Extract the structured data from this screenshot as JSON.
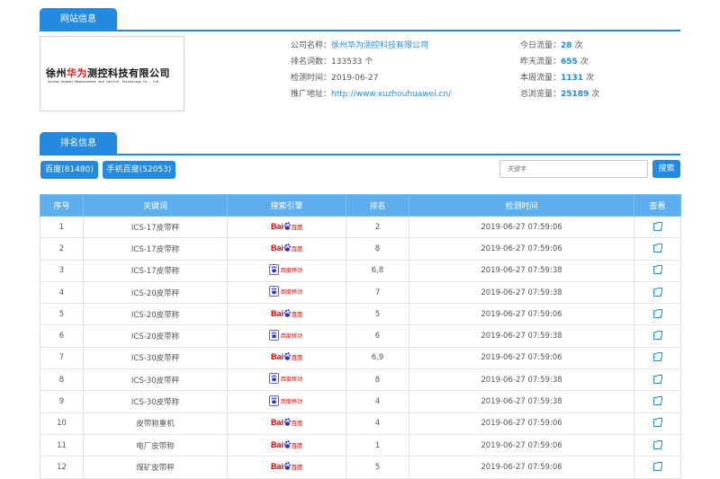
{
  "site_info": {
    "tab": "网站信息",
    "logo": {
      "brand_red": "华为",
      "text_cn": "徐州华为测控科技有限公司",
      "text_en": "Xuzhou Huawei Measurement and Control Technology Co., Ltd."
    },
    "company_label": "公司名称：",
    "company_value": "徐州华为测控科技有限公司",
    "rank_words_label": "排名词数：",
    "rank_words_value": "133533 个",
    "check_time_label": "检测时间：",
    "check_time_value": "2019-06-27",
    "url_label": "推广地址：",
    "url_value": "http://www.xuzhouhuawei.cn/",
    "traffic": [
      {
        "label": "今日流量：",
        "value": "28",
        "unit": "次"
      },
      {
        "label": "昨天流量：",
        "value": "655",
        "unit": "次"
      },
      {
        "label": "本周流量：",
        "value": "1131",
        "unit": "次"
      },
      {
        "label": "总浏览量：",
        "value": "25189",
        "unit": "次"
      }
    ]
  },
  "ranking": {
    "tab": "排名信息",
    "btn_baidu": "百度(81480)",
    "btn_mobile": "手机百度(52053)",
    "search_placeholder": "关键字",
    "search_button": "搜索",
    "columns": [
      "序号",
      "关键词",
      "搜索引擎",
      "排名",
      "检测时间",
      "查看"
    ],
    "engines": {
      "pc_bai": "Bai",
      "pc_du": "百度",
      "mobile": "百度移动"
    },
    "rows": [
      {
        "no": "1",
        "keyword": "ICS-17皮带秤",
        "engine": "pc",
        "rank": "2",
        "time": "2019-06-27 07:59:06"
      },
      {
        "no": "2",
        "keyword": "ICS-17皮带称",
        "engine": "pc",
        "rank": "8",
        "time": "2019-06-27 07:59:06"
      },
      {
        "no": "3",
        "keyword": "ICS-17皮带称",
        "engine": "mobile",
        "rank": "6,8",
        "time": "2019-06-27 07:59:38"
      },
      {
        "no": "4",
        "keyword": "ICS-20皮带秤",
        "engine": "mobile",
        "rank": "7",
        "time": "2019-06-27 07:59:38"
      },
      {
        "no": "5",
        "keyword": "ICS-20皮带称",
        "engine": "pc",
        "rank": "5",
        "time": "2019-06-27 07:59:06"
      },
      {
        "no": "6",
        "keyword": "ICS-20皮带称",
        "engine": "mobile",
        "rank": "6",
        "time": "2019-06-27 07:59:38"
      },
      {
        "no": "7",
        "keyword": "ICS-30皮带秤",
        "engine": "pc",
        "rank": "6,9",
        "time": "2019-06-27 07:59:06"
      },
      {
        "no": "8",
        "keyword": "ICS-30皮带秤",
        "engine": "mobile",
        "rank": "8",
        "time": "2019-06-27 07:59:38"
      },
      {
        "no": "9",
        "keyword": "ICS-30皮带称",
        "engine": "mobile",
        "rank": "4",
        "time": "2019-06-27 07:59:38"
      },
      {
        "no": "10",
        "keyword": "皮带称重机",
        "engine": "pc",
        "rank": "4",
        "time": "2019-06-27 07:59:06"
      },
      {
        "no": "11",
        "keyword": "电厂皮带称",
        "engine": "pc",
        "rank": "1",
        "time": "2019-06-27 07:59:06"
      },
      {
        "no": "12",
        "keyword": "煤矿皮带秤",
        "engine": "pc",
        "rank": "5",
        "time": "2019-06-27 07:59:06"
      }
    ]
  },
  "colors": {
    "accent": "#2489e0",
    "header_row": "#5eaeed",
    "baidu_red": "#e10602",
    "baidu_blue": "#2932e1"
  }
}
